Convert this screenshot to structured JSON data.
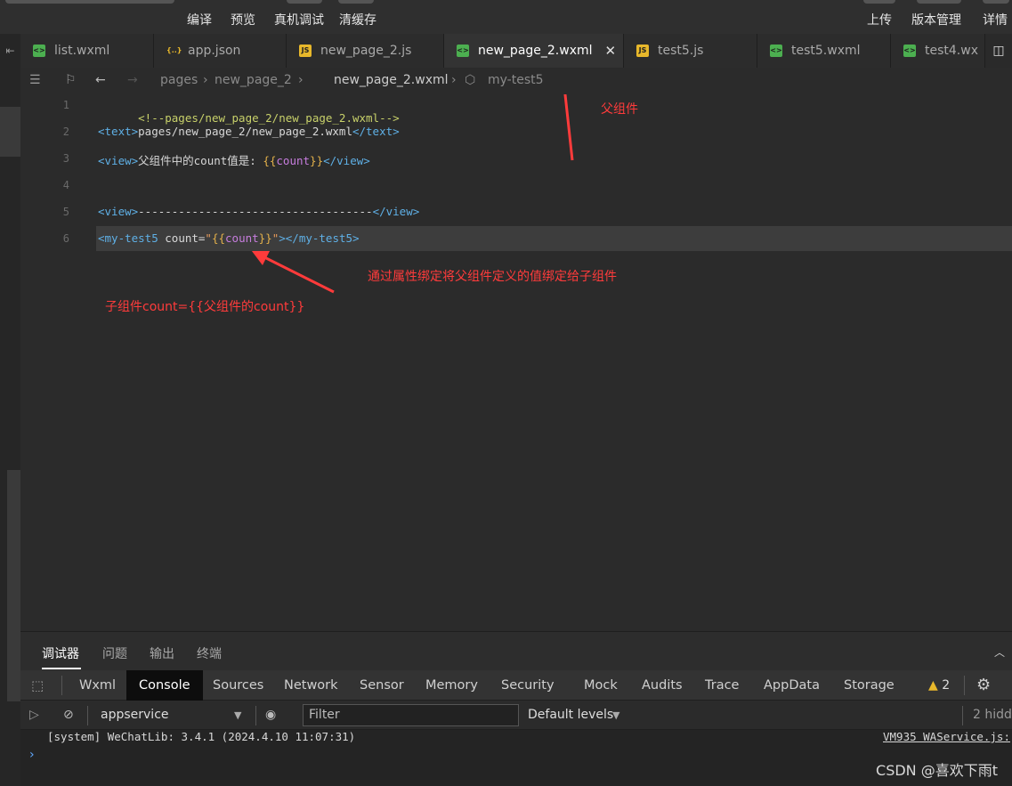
{
  "toolbar": {
    "compile": "编译",
    "preview": "预览",
    "remote_debug": "真机调试",
    "clear_cache": "清缓存",
    "upload": "上传",
    "version_mgmt": "版本管理",
    "details": "详情"
  },
  "tabs": [
    {
      "label": "list.wxml",
      "icon": "wxml-icon"
    },
    {
      "label": "app.json",
      "icon": "json-icon"
    },
    {
      "label": "new_page_2.js",
      "icon": "js-icon"
    },
    {
      "label": "new_page_2.wxml",
      "icon": "wxml-icon",
      "active": true
    },
    {
      "label": "test5.js",
      "icon": "js-icon"
    },
    {
      "label": "test5.wxml",
      "icon": "wxml-icon"
    },
    {
      "label": "test4.wx",
      "icon": "wxml-icon"
    }
  ],
  "breadcrumb": {
    "p1": "pages",
    "p2": "new_page_2",
    "p3": "new_page_2.wxml",
    "p4": "my-test5"
  },
  "code": {
    "line_numbers": [
      "1",
      "2",
      "3",
      "4",
      "5",
      "6"
    ],
    "l1": "<!--pages/new_page_2/new_page_2.wxml-->",
    "l2_open": "<text>",
    "l2_text": "pages/new_page_2/new_page_2.wxml",
    "l2_close": "</text>",
    "l3_open": "<view>",
    "l3_text": "父组件中的count值是: ",
    "l3_lb": "{{",
    "l3_var": "count",
    "l3_rb": "}}",
    "l3_close": "</view>",
    "l5_open": "<view>",
    "l5_text": "-----------------------------------",
    "l5_close": "</view>",
    "l6_open": "<my-test5 ",
    "l6_attr": "count=",
    "l6_q1": "\"",
    "l6_lb": "{{",
    "l6_var": "count",
    "l6_rb": "}}",
    "l6_q2": "\"",
    "l6_gt": ">",
    "l6_close": "</my-test5>"
  },
  "annotations": {
    "parent": "父组件",
    "binding": "通过属性绑定将父组件定义的值绑定给子组件",
    "child": "子组件count={{父组件的count}}"
  },
  "debug_tabs": [
    "调试器",
    "问题",
    "输出",
    "终端"
  ],
  "devtools_tabs": [
    "Wxml",
    "Console",
    "Sources",
    "Network",
    "Sensor",
    "Memory",
    "Security",
    "Mock",
    "Audits",
    "Trace",
    "AppData",
    "Storage"
  ],
  "devtools_active": "Console",
  "warnings_count": "2",
  "console": {
    "context": "appservice",
    "filter_placeholder": "Filter",
    "levels": "Default levels",
    "hidden": "2 hidd",
    "log_text": "[system] WeChatLib: 3.4.1 (2024.4.10 11:07:31)",
    "log_source": "VM935 WAService.js:"
  },
  "watermark": "CSDN @喜欢下雨t",
  "colors": {
    "annotation": "#ff3b3b",
    "tag": "#5fb0e6",
    "comment": "#c8d16a"
  }
}
